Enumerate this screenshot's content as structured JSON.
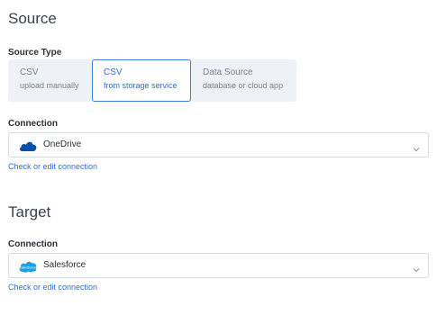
{
  "source": {
    "title": "Source",
    "type_label": "Source Type",
    "options": [
      {
        "title": "CSV",
        "subtitle": "upload manually"
      },
      {
        "title": "CSV",
        "subtitle": "from storage service"
      },
      {
        "title": "Data Source",
        "subtitle": "database or cloud app"
      }
    ],
    "selected_option": 1,
    "connection_label": "Connection",
    "connection_value": "OneDrive",
    "connection_icon": "onedrive-cloud-icon",
    "edit_link": "Check or edit connection"
  },
  "target": {
    "title": "Target",
    "connection_label": "Connection",
    "connection_value": "Salesforce",
    "connection_icon": "salesforce-cloud-icon",
    "edit_link": "Check or edit connection"
  },
  "colors": {
    "accent": "#2f6fd8",
    "onedrive": "#0a4fa8",
    "salesforce": "#1aa3e0"
  }
}
